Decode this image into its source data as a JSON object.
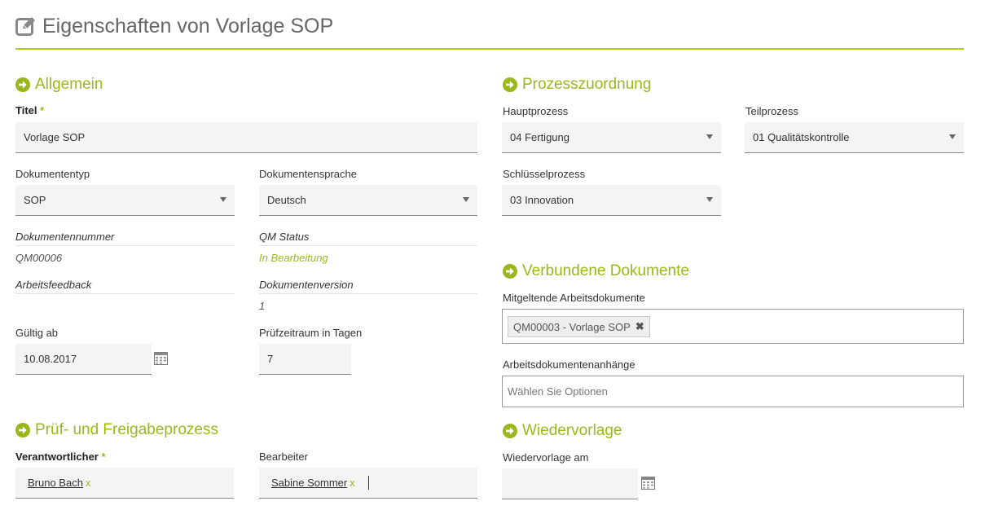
{
  "header": {
    "title": "Eigenschaften von Vorlage SOP"
  },
  "colors": {
    "accent": "#9ab81c",
    "rule": "#b5cc18"
  },
  "allgemein": {
    "section_title": "Allgemein",
    "titel_label": "Titel",
    "required_mark": "*",
    "titel_value": "Vorlage SOP",
    "dokumententyp_label": "Dokumententyp",
    "dokumententyp_value": "SOP",
    "dokumentensprache_label": "Dokumentensprache",
    "dokumentensprache_value": "Deutsch",
    "dokumentennummer_label": "Dokumentennummer",
    "dokumentennummer_value": "QM00006",
    "qm_status_label": "QM Status",
    "qm_status_value": "In Bearbeitung",
    "arbeitsfeedback_label": "Arbeitsfeedback",
    "dokumentenversion_label": "Dokumentenversion",
    "dokumentenversion_value": "1",
    "gueltig_ab_label": "Gültig ab",
    "gueltig_ab_value": "10.08.2017",
    "pruefzeitraum_label": "Prüfzeitraum in Tagen",
    "pruefzeitraum_value": "7"
  },
  "prozesszuordnung": {
    "section_title": "Prozesszuordnung",
    "hauptprozess_label": "Hauptprozess",
    "hauptprozess_value": "04 Fertigung",
    "teilprozess_label": "Teilprozess",
    "teilprozess_value": "01 Qualitätskontrolle",
    "schluesselprozess_label": "Schlüsselprozess",
    "schluesselprozess_value": "03 Innovation"
  },
  "verbundene_dokumente": {
    "section_title": "Verbundene Dokumente",
    "mitgeltende_label": "Mitgeltende Arbeitsdokumente",
    "mitgeltende_tag": "QM00003 - Vorlage SOP",
    "tag_remove": "✖",
    "anhaenge_label": "Arbeitsdokumentenanhänge",
    "anhaenge_placeholder": "Wählen Sie Optionen"
  },
  "pruef_freigabe": {
    "section_title": "Prüf- und Freigabeprozess",
    "verantwortlicher_label": "Verantwortlicher",
    "required_mark": "*",
    "verantwortlicher_value": "Bruno Bach",
    "bearbeiter_label": "Bearbeiter",
    "bearbeiter_value": "Sabine Sommer",
    "remove_mark": "x"
  },
  "wiedervorlage": {
    "section_title": "Wiedervorlage",
    "wiedervorlage_am_label": "Wiedervorlage am",
    "wiedervorlage_am_value": ""
  }
}
